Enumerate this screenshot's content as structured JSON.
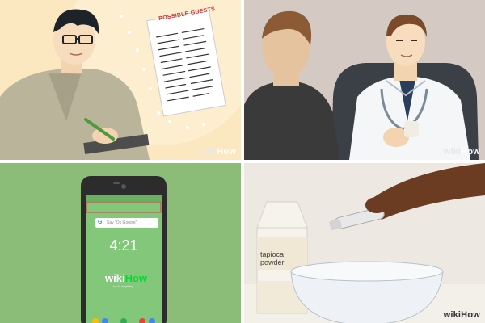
{
  "watermark": {
    "wiki": "wiki",
    "how": "How"
  },
  "panel1": {
    "list_title": "POSSIBLE GUESTS",
    "colors": {
      "background": "#fbe7c0",
      "shirt": "#b9b49a",
      "pen": "#4a9a3e"
    }
  },
  "panel2": {
    "colors": {
      "background": "#d8cfc8",
      "coat": "#f4f6f8",
      "tie": "#2b3f5c"
    }
  },
  "panel3": {
    "search_placeholder": "Say \"Ok Google\"",
    "google_letter": "G",
    "time": "4:21",
    "date": "",
    "logo_wiki": "wiki",
    "logo_how": "How",
    "tagline": "to do anything",
    "colors": {
      "background": "#8cbd78",
      "screen": "#82c77a"
    }
  },
  "panel4": {
    "bag_label_line1": "tapioca",
    "bag_label_line2": "powder",
    "colors": {
      "background": "#ede8e1",
      "table": "#f3efe9",
      "bowl": "#eef2f6"
    }
  }
}
